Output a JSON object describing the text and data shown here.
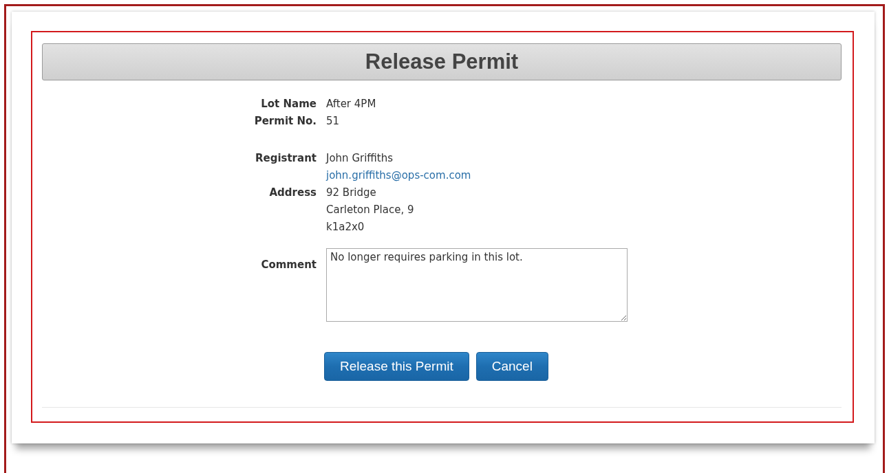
{
  "title": "Release Permit",
  "details": [
    {
      "label": "Lot Name",
      "lines": [
        {
          "kind": "text",
          "text": "After 4PM"
        }
      ]
    },
    {
      "label": "Permit No.",
      "lines": [
        {
          "kind": "text",
          "text": "51"
        }
      ]
    },
    {
      "kind": "gap"
    },
    {
      "label": "Registrant",
      "lines": [
        {
          "kind": "text",
          "text": "John Griffiths"
        },
        {
          "kind": "link",
          "text": "john.griffiths@ops-com.com"
        }
      ]
    },
    {
      "label": "Address",
      "lines": [
        {
          "kind": "text",
          "text": "92 Bridge"
        },
        {
          "kind": "text",
          "text": "Carleton Place, 9"
        },
        {
          "kind": "text",
          "text": "k1a2x0"
        }
      ]
    }
  ],
  "comment": {
    "label": "Comment",
    "value": "No longer requires parking in this lot."
  },
  "buttons": [
    "Release this Permit",
    "Cancel"
  ]
}
